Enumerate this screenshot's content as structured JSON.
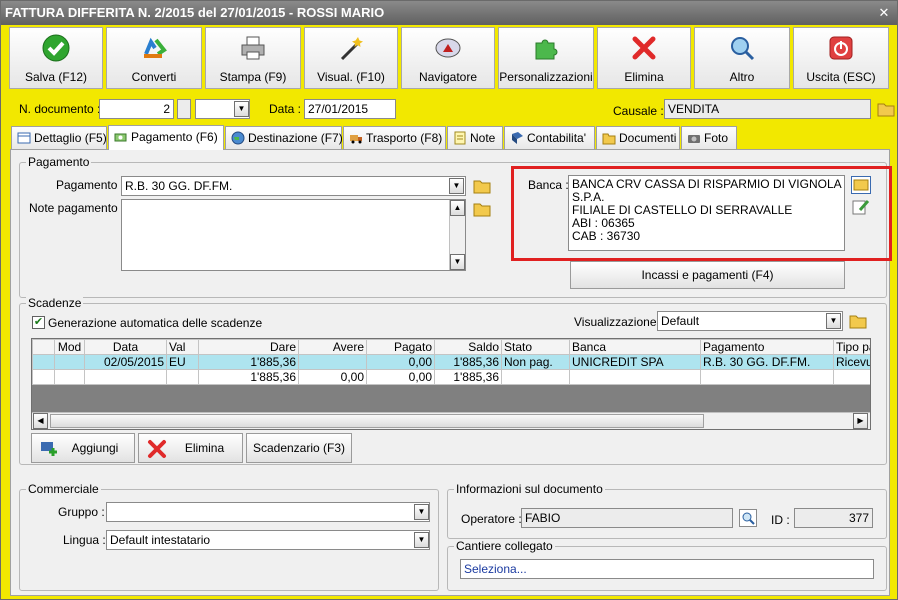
{
  "window": {
    "title": "FATTURA DIFFERITA N. 2/2015 del 27/01/2015 - ROSSI MARIO",
    "close": "✕"
  },
  "toolbar": [
    {
      "label": "Salva (F12)",
      "icon": "check-icon"
    },
    {
      "label": "Converti",
      "icon": "recycle-icon"
    },
    {
      "label": "Stampa (F9)",
      "icon": "printer-icon"
    },
    {
      "label": "Visual. (F10)",
      "icon": "magic-wand-icon"
    },
    {
      "label": "Navigatore",
      "icon": "compass-icon"
    },
    {
      "label": "Personalizzazioni",
      "icon": "puzzle-icon"
    },
    {
      "label": "Elimina",
      "icon": "cross-icon"
    },
    {
      "label": "Altro",
      "icon": "magnifier-icon"
    },
    {
      "label": "Uscita (ESC)",
      "icon": "power-icon"
    }
  ],
  "header": {
    "ndoc_label": "N. documento :",
    "ndoc_value": "2",
    "suffix_value": "",
    "data_label": "Data :",
    "data_value": "27/01/2015",
    "causale_label": "Causale :",
    "causale_value": "VENDITA"
  },
  "tabs": [
    {
      "label": "Dettaglio (F5)"
    },
    {
      "label": "Pagamento (F6)"
    },
    {
      "label": "Destinazione (F7)"
    },
    {
      "label": "Trasporto (F8)"
    },
    {
      "label": "Note"
    },
    {
      "label": "Contabilita'"
    },
    {
      "label": "Documenti"
    },
    {
      "label": "Foto"
    }
  ],
  "pagamento": {
    "group_title": "Pagamento",
    "pagamento_label": "Pagamento :",
    "pagamento_value": "R.B. 30 GG. DF.FM.",
    "note_label": "Note pagamento :",
    "note_value": "",
    "banca_label": "Banca :",
    "banca_lines": [
      "BANCA CRV CASSA DI RISPARMIO DI VIGNOLA S.P.A.",
      "FILIALE DI CASTELLO DI SERRAVALLE",
      "ABI : 06365",
      "CAB : 36730"
    ],
    "incassi_button": "Incassi e pagamenti (F4)"
  },
  "scadenze": {
    "group_title": "Scadenze",
    "auto_label": "Generazione automatica delle scadenze",
    "auto_checked": true,
    "vis_label": "Visualizzazione :",
    "vis_value": "Default",
    "columns": [
      "Mod",
      "Data",
      "Val",
      "Dare",
      "Avere",
      "Pagato",
      "Saldo",
      "Stato",
      "Banca",
      "Pagamento",
      "Tipo pag."
    ],
    "rows": [
      [
        "",
        "02/05/2015",
        "EU",
        "1'885,36",
        "",
        "0,00",
        "1'885,36",
        "Non pag.",
        "UNICREDIT SPA",
        "R.B. 30 GG. DF.FM.",
        "Ricevuta banc"
      ],
      [
        "",
        "",
        "",
        "1'885,36",
        "0,00",
        "0,00",
        "1'885,36",
        "",
        "",
        "",
        ""
      ]
    ],
    "add_button": "Aggiungi",
    "delete_button": "Elimina",
    "scadenzario_button": "Scadenzario (F3)"
  },
  "commerciale": {
    "group_title": "Commerciale",
    "gruppo_label": "Gruppo :",
    "gruppo_value": "",
    "lingua_label": "Lingua :",
    "lingua_value": "Default intestatario"
  },
  "info": {
    "group_title": "Informazioni sul documento",
    "operatore_label": "Operatore :",
    "operatore_value": "FABIO",
    "id_label": "ID :",
    "id_value": "377"
  },
  "cantiere": {
    "group_title": "Cantiere collegato",
    "value": "Seleziona..."
  },
  "colors": {
    "accent_yellow": "#f2e800",
    "selected_row": "#aee4ef",
    "highlight_box": "#e02020"
  }
}
